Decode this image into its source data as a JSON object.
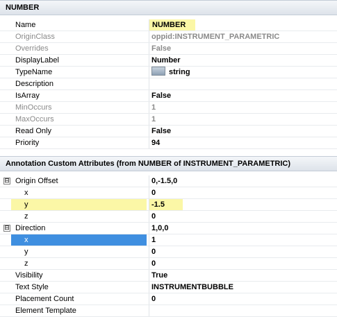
{
  "sections": {
    "main_title": "NUMBER",
    "annotation_title": "Annotation Custom Attributes (from NUMBER of INSTRUMENT_PARAMETRIC)"
  },
  "properties": [
    {
      "name": "Name",
      "value": "NUMBER"
    },
    {
      "name": "OriginClass",
      "value": "oppid:INSTRUMENT_PARAMETRIC"
    },
    {
      "name": "Overrides",
      "value": "False"
    },
    {
      "name": "DisplayLabel",
      "value": "Number"
    },
    {
      "name": "TypeName",
      "value": "string",
      "icon": "type-icon"
    },
    {
      "name": "Description",
      "value": ""
    },
    {
      "name": "IsArray",
      "value": "False"
    },
    {
      "name": "MinOccurs",
      "value": "1"
    },
    {
      "name": "MaxOccurs",
      "value": "1"
    },
    {
      "name": "Read Only",
      "value": "False"
    },
    {
      "name": "Priority",
      "value": "94"
    }
  ],
  "annotation": [
    {
      "name": "Origin Offset",
      "value": "0,-1.5,0",
      "toggle": "⊟"
    },
    {
      "name": "x",
      "value": "0"
    },
    {
      "name": "y",
      "value": "-1.5"
    },
    {
      "name": "z",
      "value": "0"
    },
    {
      "name": "Direction",
      "value": "1,0,0",
      "toggle": "⊟"
    },
    {
      "name": "x",
      "value": "1"
    },
    {
      "name": "y",
      "value": "0"
    },
    {
      "name": "z",
      "value": "0"
    },
    {
      "name": "Visibility",
      "value": "True"
    },
    {
      "name": "Text Style",
      "value": "INSTRUMENTBUBBLE"
    },
    {
      "name": "Placement Count",
      "value": "0"
    },
    {
      "name": "Element Template",
      "value": ""
    }
  ],
  "colors": {
    "highlight": "#fbf7a6",
    "selection": "#3f8fe0"
  }
}
